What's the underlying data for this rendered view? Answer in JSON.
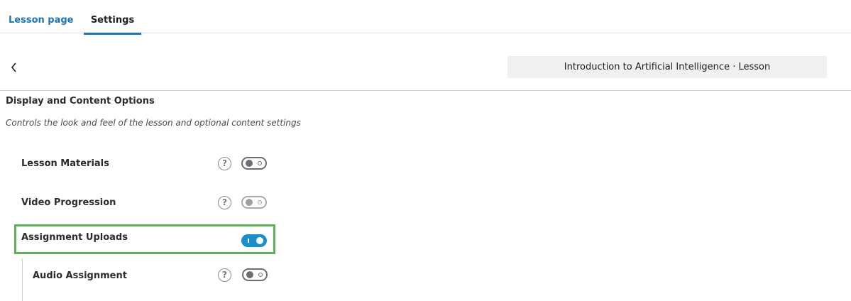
{
  "tabs": [
    {
      "label": "Lesson page",
      "active": false
    },
    {
      "label": "Settings",
      "active": true
    }
  ],
  "breadcrumb": "Introduction to Artificial Intelligence · Lesson",
  "section": {
    "title": "Display and Content Options",
    "description": "Controls the look and feel of the lesson and optional content settings"
  },
  "settings": [
    {
      "label": "Lesson Materials",
      "help_icon": "question-circle-icon",
      "enabled": false
    },
    {
      "label": "Video Progression",
      "help_icon": "question-circle-icon",
      "enabled": false
    },
    {
      "label": "Assignment Uploads",
      "enabled": true,
      "highlighted": true
    },
    {
      "label": "Audio Assignment",
      "help_icon": "question-circle-icon",
      "enabled": false
    }
  ],
  "icons": {
    "back": "chevron-left-icon",
    "help_glyph": "?"
  },
  "colors": {
    "accent": "#1e74b5",
    "toggle_on": "#1a8fca",
    "highlight_border": "#5fb05a"
  }
}
